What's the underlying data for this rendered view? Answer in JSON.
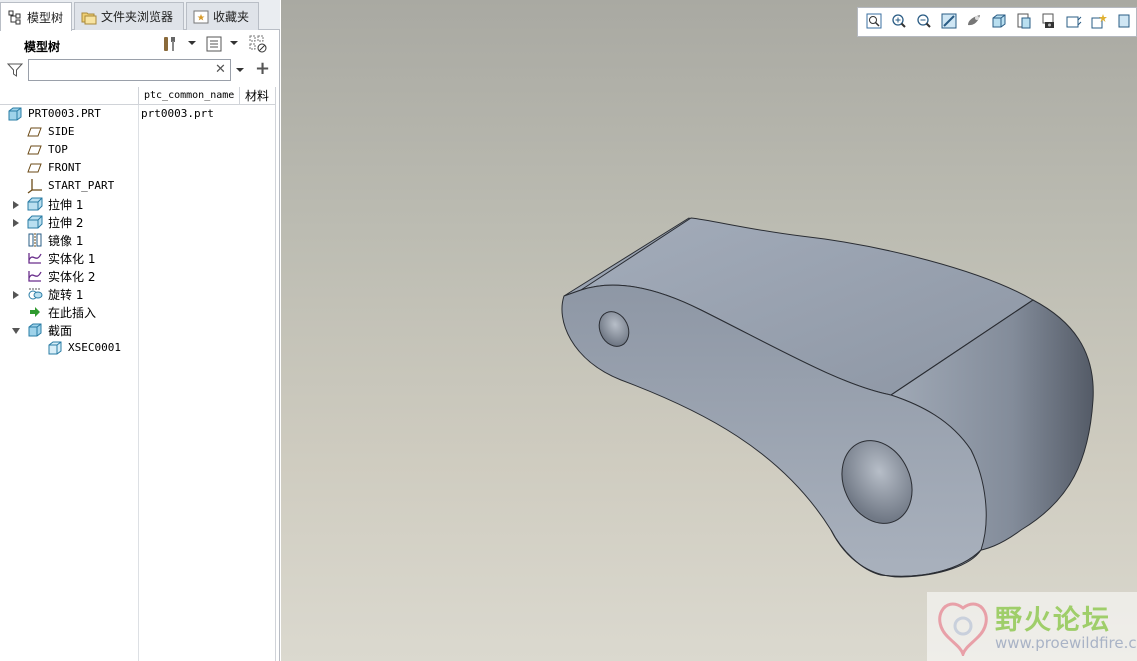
{
  "tabs": [
    {
      "label": "模型树",
      "icon": "model-tree-icon",
      "active": true
    },
    {
      "label": "文件夹浏览器",
      "icon": "folder-browser-icon",
      "active": false
    },
    {
      "label": "收藏夹",
      "icon": "favorites-icon",
      "active": false
    }
  ],
  "tree_panel": {
    "title": "模型树",
    "search_value": "",
    "columns": [
      "ptc_common_name",
      "材料"
    ]
  },
  "tree": {
    "items": [
      {
        "label": "PRT0003.PRT",
        "icon": "part-icon",
        "value": "prt0003.prt"
      },
      {
        "label": "SIDE",
        "icon": "datum-plane-icon"
      },
      {
        "label": "TOP",
        "icon": "datum-plane-icon"
      },
      {
        "label": "FRONT",
        "icon": "datum-plane-icon"
      },
      {
        "label": "START_PART",
        "icon": "coordinate-system-icon"
      },
      {
        "label": "拉伸 1",
        "icon": "extrude-icon",
        "expandable": true
      },
      {
        "label": "拉伸 2",
        "icon": "extrude-icon",
        "expandable": true
      },
      {
        "label": "镜像 1",
        "icon": "mirror-icon"
      },
      {
        "label": "实体化 1",
        "icon": "solidify-icon"
      },
      {
        "label": "实体化 2",
        "icon": "solidify-icon"
      },
      {
        "label": "旋转 1",
        "icon": "revolve-icon",
        "expandable": true
      },
      {
        "label": "在此插入",
        "icon": "insert-here-arrow-icon"
      },
      {
        "label": "截面",
        "icon": "section-icon",
        "expanded": true
      },
      {
        "label": "XSEC0001",
        "icon": "section-icon"
      }
    ]
  },
  "graphics_toolbar": {
    "icons": [
      "refit-icon",
      "zoom-in-icon",
      "zoom-out-icon",
      "repaint-icon",
      "display-style-icon",
      "saved-orientations-icon",
      "view-manager-icon",
      "perspective-view-icon",
      "datum-display-icon",
      "annotation-display-icon",
      "more-icon"
    ]
  },
  "watermark": {
    "title": "野火论坛",
    "url": "www.proewildfire.cn"
  },
  "colors": {
    "model_fill": "#9aa3b1",
    "model_dark": "#5f6673",
    "background_top": "#a9a9a2",
    "background_bottom": "#dbd9cf",
    "watermark_green": "#9fce6a"
  }
}
